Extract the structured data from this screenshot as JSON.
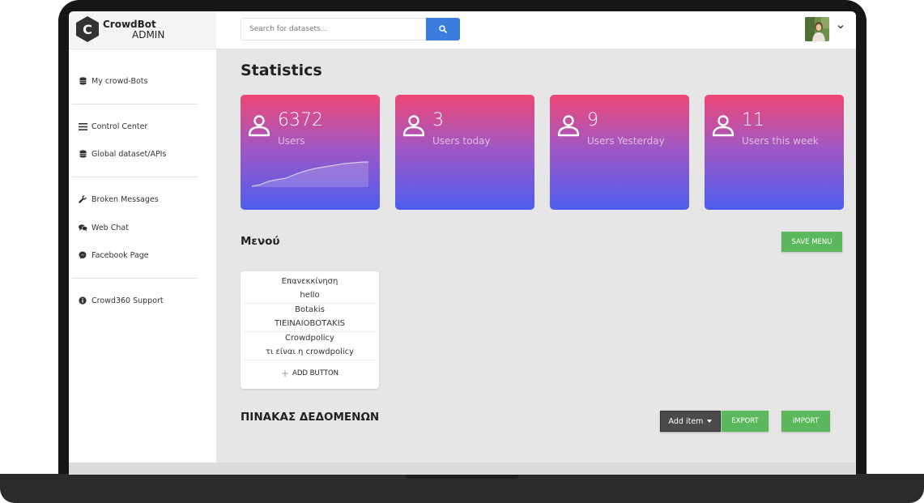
{
  "brand": {
    "letter": "C",
    "name": "CrowdBot",
    "sub": "ADMIN"
  },
  "search": {
    "placeholder": "Search for datasets..."
  },
  "sidebar": {
    "items": [
      {
        "label": "My crowd-Bots",
        "icon": "database-icon"
      },
      {
        "label": "Control Center",
        "icon": "list-icon"
      },
      {
        "label": "Global dataset/APIs",
        "icon": "database-icon"
      },
      {
        "label": "Broken Messages",
        "icon": "wrench-icon"
      },
      {
        "label": "Web Chat",
        "icon": "chat-icon"
      },
      {
        "label": "Facebook Page",
        "icon": "messenger-icon"
      },
      {
        "label": "Crowd360 Support",
        "icon": "info-icon"
      }
    ]
  },
  "page": {
    "title": "Statistics"
  },
  "stats": [
    {
      "value": "6372",
      "label": "Users"
    },
    {
      "value": "3",
      "label": "Users today"
    },
    {
      "value": "9",
      "label": "Users Yesterday"
    },
    {
      "value": "11",
      "label": "Users this week"
    }
  ],
  "menu": {
    "title": "Μενού",
    "save_label": "SAVE MENU",
    "items": [
      "Επανεκκίνηση",
      "hello",
      "Botakis",
      "ΤΙΕΙΝΑΙΟΒΟΤΑΚΙS",
      "Crowdpolicy",
      "τι είναι η crowdpolicy"
    ],
    "add_label": "ADD BUTTON"
  },
  "table": {
    "title": "ΠΙΝΑΚΑΣ ΔΕΔΟΜΕΝΩΝ",
    "add_item_label": "Add item",
    "export_label": "EXPORT",
    "import_label": "IMPORT"
  },
  "colors": {
    "accent": "#3b7ddd",
    "green": "#5cb85c",
    "card_top": "#ef4776",
    "card_bottom": "#4d5ef0"
  }
}
